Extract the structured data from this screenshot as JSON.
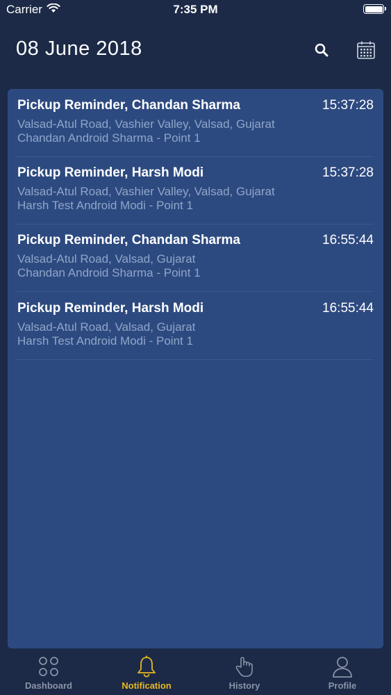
{
  "status_bar": {
    "carrier": "Carrier",
    "time": "7:35 PM"
  },
  "header": {
    "title": "08 June 2018"
  },
  "notifications": [
    {
      "title": "Pickup Reminder, Chandan Sharma",
      "time": "15:37:28",
      "line1": "Valsad-Atul Road, Vashier Valley, Valsad, Gujarat",
      "line2": "Chandan Android Sharma - Point 1"
    },
    {
      "title": "Pickup Reminder, Harsh Modi",
      "time": "15:37:28",
      "line1": "Valsad-Atul Road, Vashier Valley, Valsad, Gujarat",
      "line2": "Harsh Test Android Modi - Point 1"
    },
    {
      "title": "Pickup Reminder, Chandan Sharma",
      "time": "16:55:44",
      "line1": "Valsad-Atul Road, Valsad, Gujarat",
      "line2": "Chandan Android Sharma - Point 1"
    },
    {
      "title": "Pickup Reminder, Harsh Modi",
      "time": "16:55:44",
      "line1": "Valsad-Atul Road, Valsad, Gujarat",
      "line2": "Harsh Test Android Modi - Point 1"
    }
  ],
  "tabs": [
    {
      "label": "Dashboard",
      "icon": "dashboard-icon"
    },
    {
      "label": "Notification",
      "icon": "bell-icon",
      "active": true
    },
    {
      "label": "History",
      "icon": "hand-pointer-icon"
    },
    {
      "label": "Profile",
      "icon": "user-icon"
    }
  ],
  "colors": {
    "background": "#1c2a47",
    "panel": "#2d4a80",
    "accent": "#e8b923",
    "secondary_text": "#8fa6c9"
  }
}
